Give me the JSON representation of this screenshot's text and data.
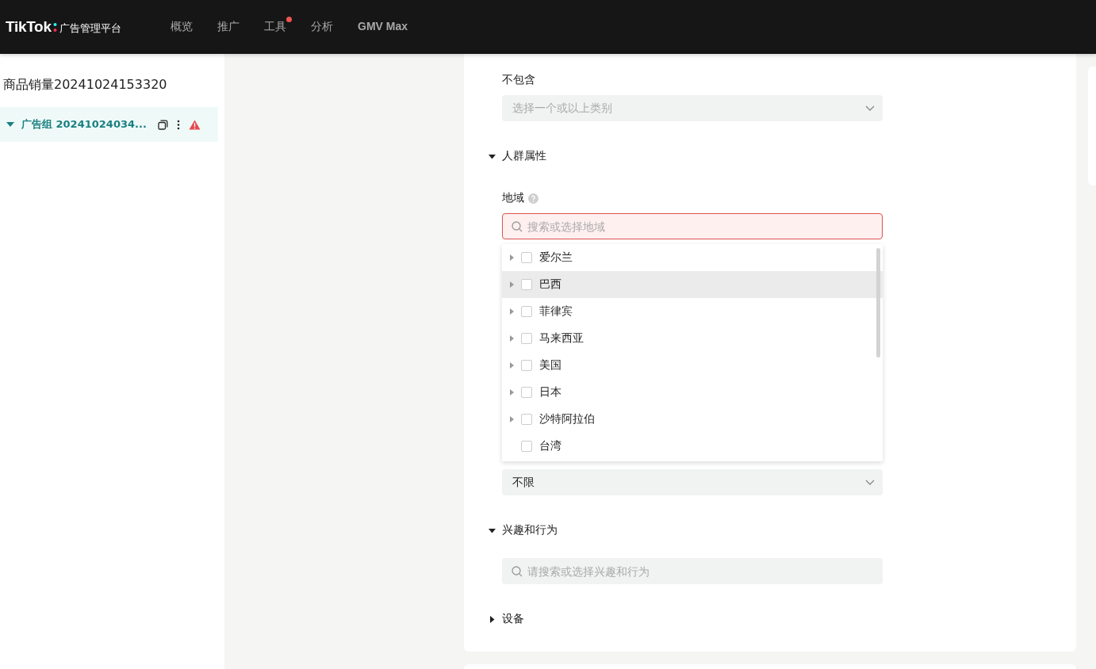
{
  "header": {
    "logo": "TikTok",
    "logo_sub": "广告管理平台",
    "nav": [
      {
        "label": "概览",
        "badge": false,
        "emphasis": false
      },
      {
        "label": "推广",
        "badge": false,
        "emphasis": false
      },
      {
        "label": "工具",
        "badge": true,
        "emphasis": false
      },
      {
        "label": "分析",
        "badge": false,
        "emphasis": false
      },
      {
        "label": "GMV Max",
        "badge": false,
        "emphasis": true
      }
    ]
  },
  "sidebar": {
    "campaign": "商品销量20241024153320",
    "ad_group": {
      "label": "广告组 20241024034...",
      "expanded": true,
      "selected": true,
      "warning": true
    }
  },
  "form": {
    "exclude": {
      "label": "不包含",
      "placeholder": "选择一个或以上类别"
    },
    "sections": [
      {
        "title": "人群属性",
        "expanded": true,
        "location": {
          "label": "地域",
          "placeholder": "搜索或选择地域",
          "error": true,
          "options": [
            {
              "label": "爱尔兰",
              "expandable": true,
              "checked": false,
              "highlighted": false
            },
            {
              "label": "巴西",
              "expandable": true,
              "checked": false,
              "highlighted": true
            },
            {
              "label": "菲律宾",
              "expandable": true,
              "checked": false,
              "highlighted": false
            },
            {
              "label": "马来西亚",
              "expandable": true,
              "checked": false,
              "highlighted": false
            },
            {
              "label": "美国",
              "expandable": true,
              "checked": false,
              "highlighted": false
            },
            {
              "label": "日本",
              "expandable": true,
              "checked": false,
              "highlighted": false
            },
            {
              "label": "沙特阿拉伯",
              "expandable": true,
              "checked": false,
              "highlighted": false
            },
            {
              "label": "台湾",
              "expandable": false,
              "checked": false,
              "highlighted": false
            }
          ]
        },
        "select_value": "不限"
      },
      {
        "title": "兴趣和行为",
        "expanded": true,
        "search_placeholder": "请搜索或选择兴趣和行为"
      },
      {
        "title": "设备",
        "expanded": false
      }
    ]
  }
}
